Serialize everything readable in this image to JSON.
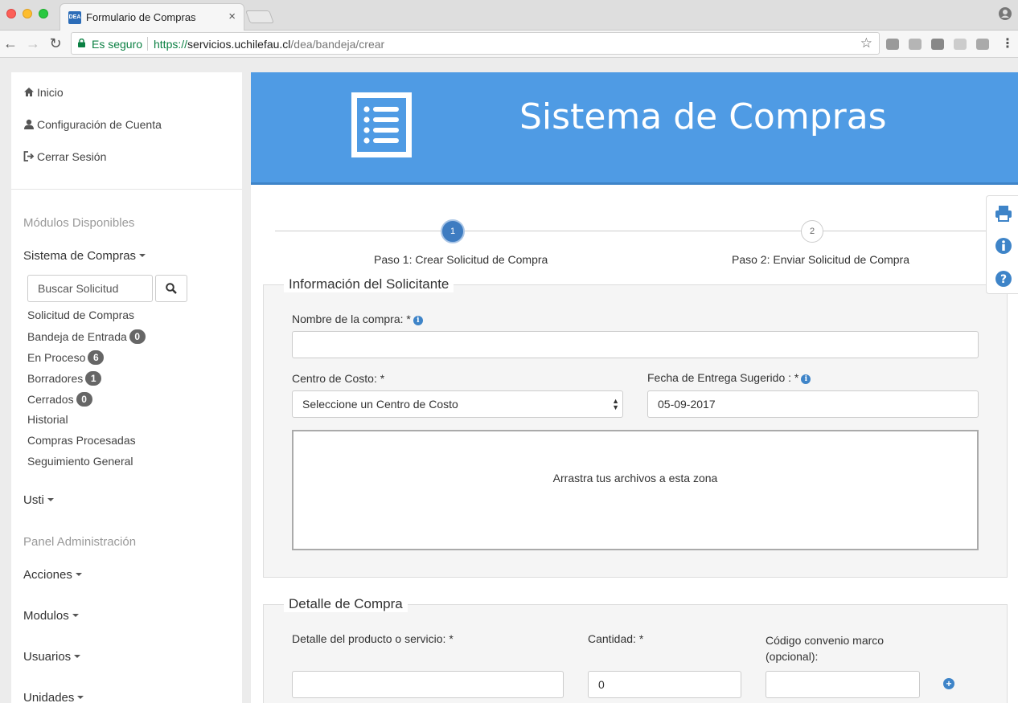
{
  "browser": {
    "tab_title": "Formulario de Compras",
    "tab_favicon_text": "DEA",
    "secure_label": "Es seguro",
    "url_scheme": "https://",
    "url_host": "servicios.uchilefau.cl",
    "url_path": "/dea/bandeja/crear"
  },
  "sidebar": {
    "top_links": [
      {
        "label": "Inicio",
        "icon": "home-icon"
      },
      {
        "label": "Configuración de Cuenta",
        "icon": "user-icon"
      },
      {
        "label": "Cerrar Sesión",
        "icon": "logout-icon"
      }
    ],
    "modules_header": "Módulos Disponibles",
    "compras_menu": "Sistema de Compras",
    "search_placeholder": "Buscar Solicitud",
    "items": [
      {
        "label": "Solicitud de Compras",
        "badge": null
      },
      {
        "label": "Bandeja de Entrada",
        "badge": "0"
      },
      {
        "label": "En Proceso",
        "badge": "6"
      },
      {
        "label": "Borradores",
        "badge": "1"
      },
      {
        "label": "Cerrados",
        "badge": "0"
      },
      {
        "label": "Historial",
        "badge": null
      },
      {
        "label": "Compras Procesadas",
        "badge": null
      },
      {
        "label": "Seguimiento General",
        "badge": null
      }
    ],
    "usti_menu": "Usti",
    "admin_header": "Panel Administración",
    "admin_menus": [
      "Acciones",
      "Modulos",
      "Usuarios",
      "Unidades"
    ]
  },
  "banner": {
    "title": "Sistema de Compras",
    "icon": "list-document-icon",
    "color": "#4f9be4"
  },
  "steps": [
    {
      "number": "1",
      "label": "Paso 1: Crear Solicitud de Compra",
      "active": true
    },
    {
      "number": "2",
      "label": "Paso 2: Enviar Solicitud de Compra",
      "active": false
    }
  ],
  "solicitante": {
    "legend": "Información del Solicitante",
    "nombre_label": "Nombre de la compra: *",
    "nombre_value": "",
    "centro_label": "Centro de Costo: *",
    "centro_value": "Seleccione un Centro de Costo",
    "fecha_label": "Fecha de Entrega Sugerido : *",
    "fecha_value": "05-09-2017",
    "dropzone_text": "Arrastra tus archivos a esta zona"
  },
  "detalle": {
    "legend": "Detalle de Compra",
    "producto_label": "Detalle del producto o servicio: *",
    "producto_value": "",
    "cantidad_label": "Cantidad: *",
    "cantidad_value": "0",
    "codigo_label_1": "Código convenio marco",
    "codigo_label_2": "(opcional):",
    "codigo_value": ""
  },
  "floating_tools": [
    "print-icon",
    "info-icon",
    "help-icon"
  ]
}
